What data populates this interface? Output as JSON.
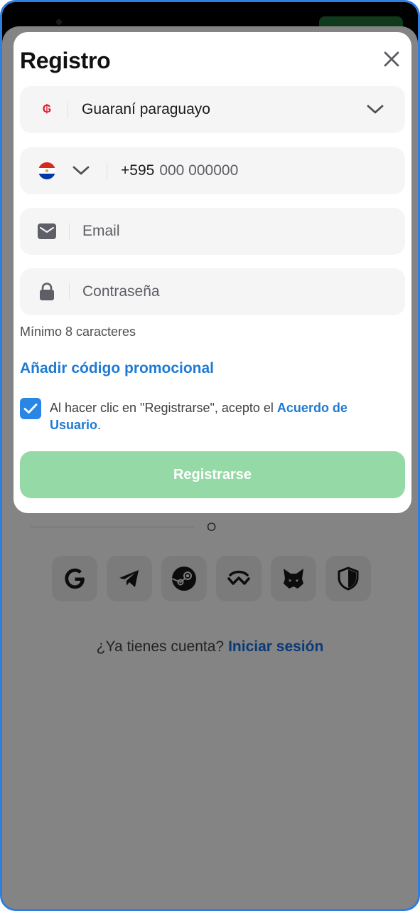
{
  "modal": {
    "title": "Registro",
    "currency": {
      "symbol": "₲",
      "value": "Guaraní paraguayo"
    },
    "phone": {
      "prefix": "+595",
      "placeholder": "000 000000"
    },
    "email": {
      "placeholder": "Email"
    },
    "password": {
      "placeholder": "Contraseña",
      "hint": "Mínimo 8 caracteres"
    },
    "promo_label": "Añadir código promocional",
    "terms": {
      "checked": true,
      "text": "Al hacer clic en \"Registrarse\", acepto el ",
      "link": "Acuerdo de Usuario",
      "end": "."
    },
    "register_label": "Registrarse"
  },
  "below": {
    "divider_text": "O",
    "social_providers": [
      "google-icon",
      "telegram-icon",
      "steam-icon",
      "walletconnect-icon",
      "metamask-icon",
      "shield-icon"
    ],
    "login_prompt": "¿Ya tienes cuenta?",
    "login_link": "Iniciar sesión"
  },
  "colors": {
    "accent_blue": "#1e7ad3",
    "checkbox_blue": "#2a86e4",
    "register_green_disabled": "#94d9a6",
    "overlay_gray": "#848484"
  }
}
